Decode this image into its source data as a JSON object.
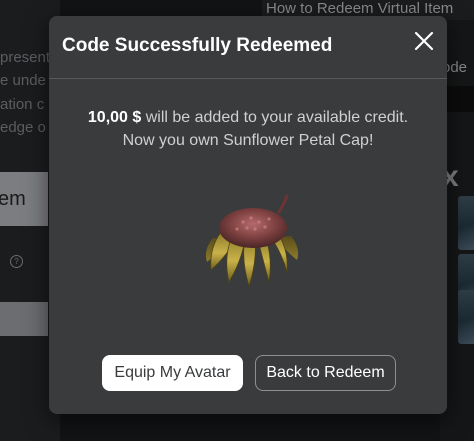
{
  "background": {
    "left_lines": [
      "present",
      "e unde",
      "ation c",
      "edge o"
    ],
    "input_text": "em",
    "help_icon": "?",
    "top_right_link": "How to Redeem Virtual Item",
    "right_text": "ode",
    "right_glyph": "x"
  },
  "modal": {
    "title": "Code Successfully Redeemed",
    "close_icon": "close-icon",
    "message": {
      "amount": "10,00 $",
      "line1_rest": " will be added to your available credit.",
      "line2": "Now you own Sunflower Petal Cap!"
    },
    "item_name": "Sunflower Petal Cap",
    "buttons": {
      "primary": "Equip My Avatar",
      "secondary": "Back to Redeem"
    }
  },
  "colors": {
    "modal_bg": "#393b3d",
    "primary_bg": "#ffffff",
    "page_bg": "#121314"
  }
}
